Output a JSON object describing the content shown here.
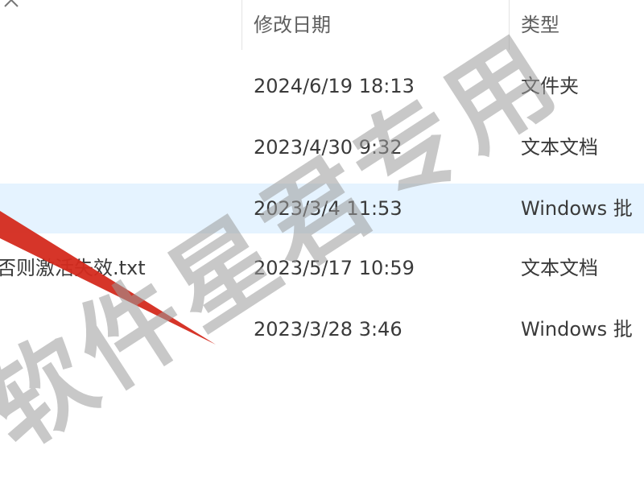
{
  "header": {
    "columns": [
      {
        "label": "修改日期"
      },
      {
        "label": "类型"
      }
    ]
  },
  "rows": [
    {
      "name": "",
      "modified": "2024/6/19 18:13",
      "type": "文件夹"
    },
    {
      "name": "",
      "modified": "2023/4/30 9:32",
      "type": "文本文档"
    },
    {
      "name": "",
      "modified": "2023/3/4 11:53",
      "type": "Windows 批"
    },
    {
      "name": "否则激活失效.txt",
      "modified": "2023/5/17 10:59",
      "type": "文本文档"
    },
    {
      "name": "",
      "modified": "2023/3/28 3:46",
      "type": "Windows 批"
    }
  ],
  "watermark": {
    "text": "软件星君专用",
    "color": "#9a9a9a"
  },
  "colors": {
    "selected_row": "#e5f3ff",
    "annotation_arrow": "#d42a1e"
  },
  "icons": {
    "collapse": "chevron-up-icon"
  }
}
